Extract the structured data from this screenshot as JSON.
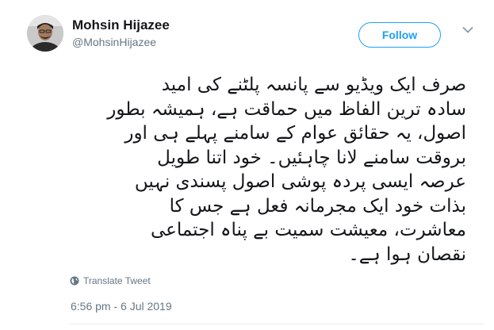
{
  "author": {
    "display_name": "Mohsin Hijazee",
    "handle": "@MohsinHijazee",
    "avatar": "profile-photo"
  },
  "actions": {
    "follow_label": "Follow",
    "menu_icon": "chevron-down-icon"
  },
  "tweet": {
    "lines": [
      "صرف ایک ویڈیو سے پانسہ پلٹنے کی امید",
      "سادہ ترین الفاظ میں حماقت ہے، ہمیشہ بطور",
      "اصول، یہ حقائق عوام کے سامنے پہلے ہی اور",
      "بروقت سامنے لانا چاہئیں۔ خود اتنا طویل",
      "عرصہ ایسی پردہ پوشی اصول پسندی نہیں",
      "بذات خود ایک مجرمانہ فعل ہے جس کا",
      "معاشرت، معیشت سمیت بے پناہ اجتماعی",
      "نقصان ہوا ہے۔"
    ],
    "translate_label": "Translate Tweet",
    "translate_icon": "globe-icon",
    "timestamp": "6:56 pm - 6 Jul 2019"
  },
  "colors": {
    "accent": "#1da1f2",
    "text_primary": "#14171a",
    "text_secondary": "#657786"
  }
}
